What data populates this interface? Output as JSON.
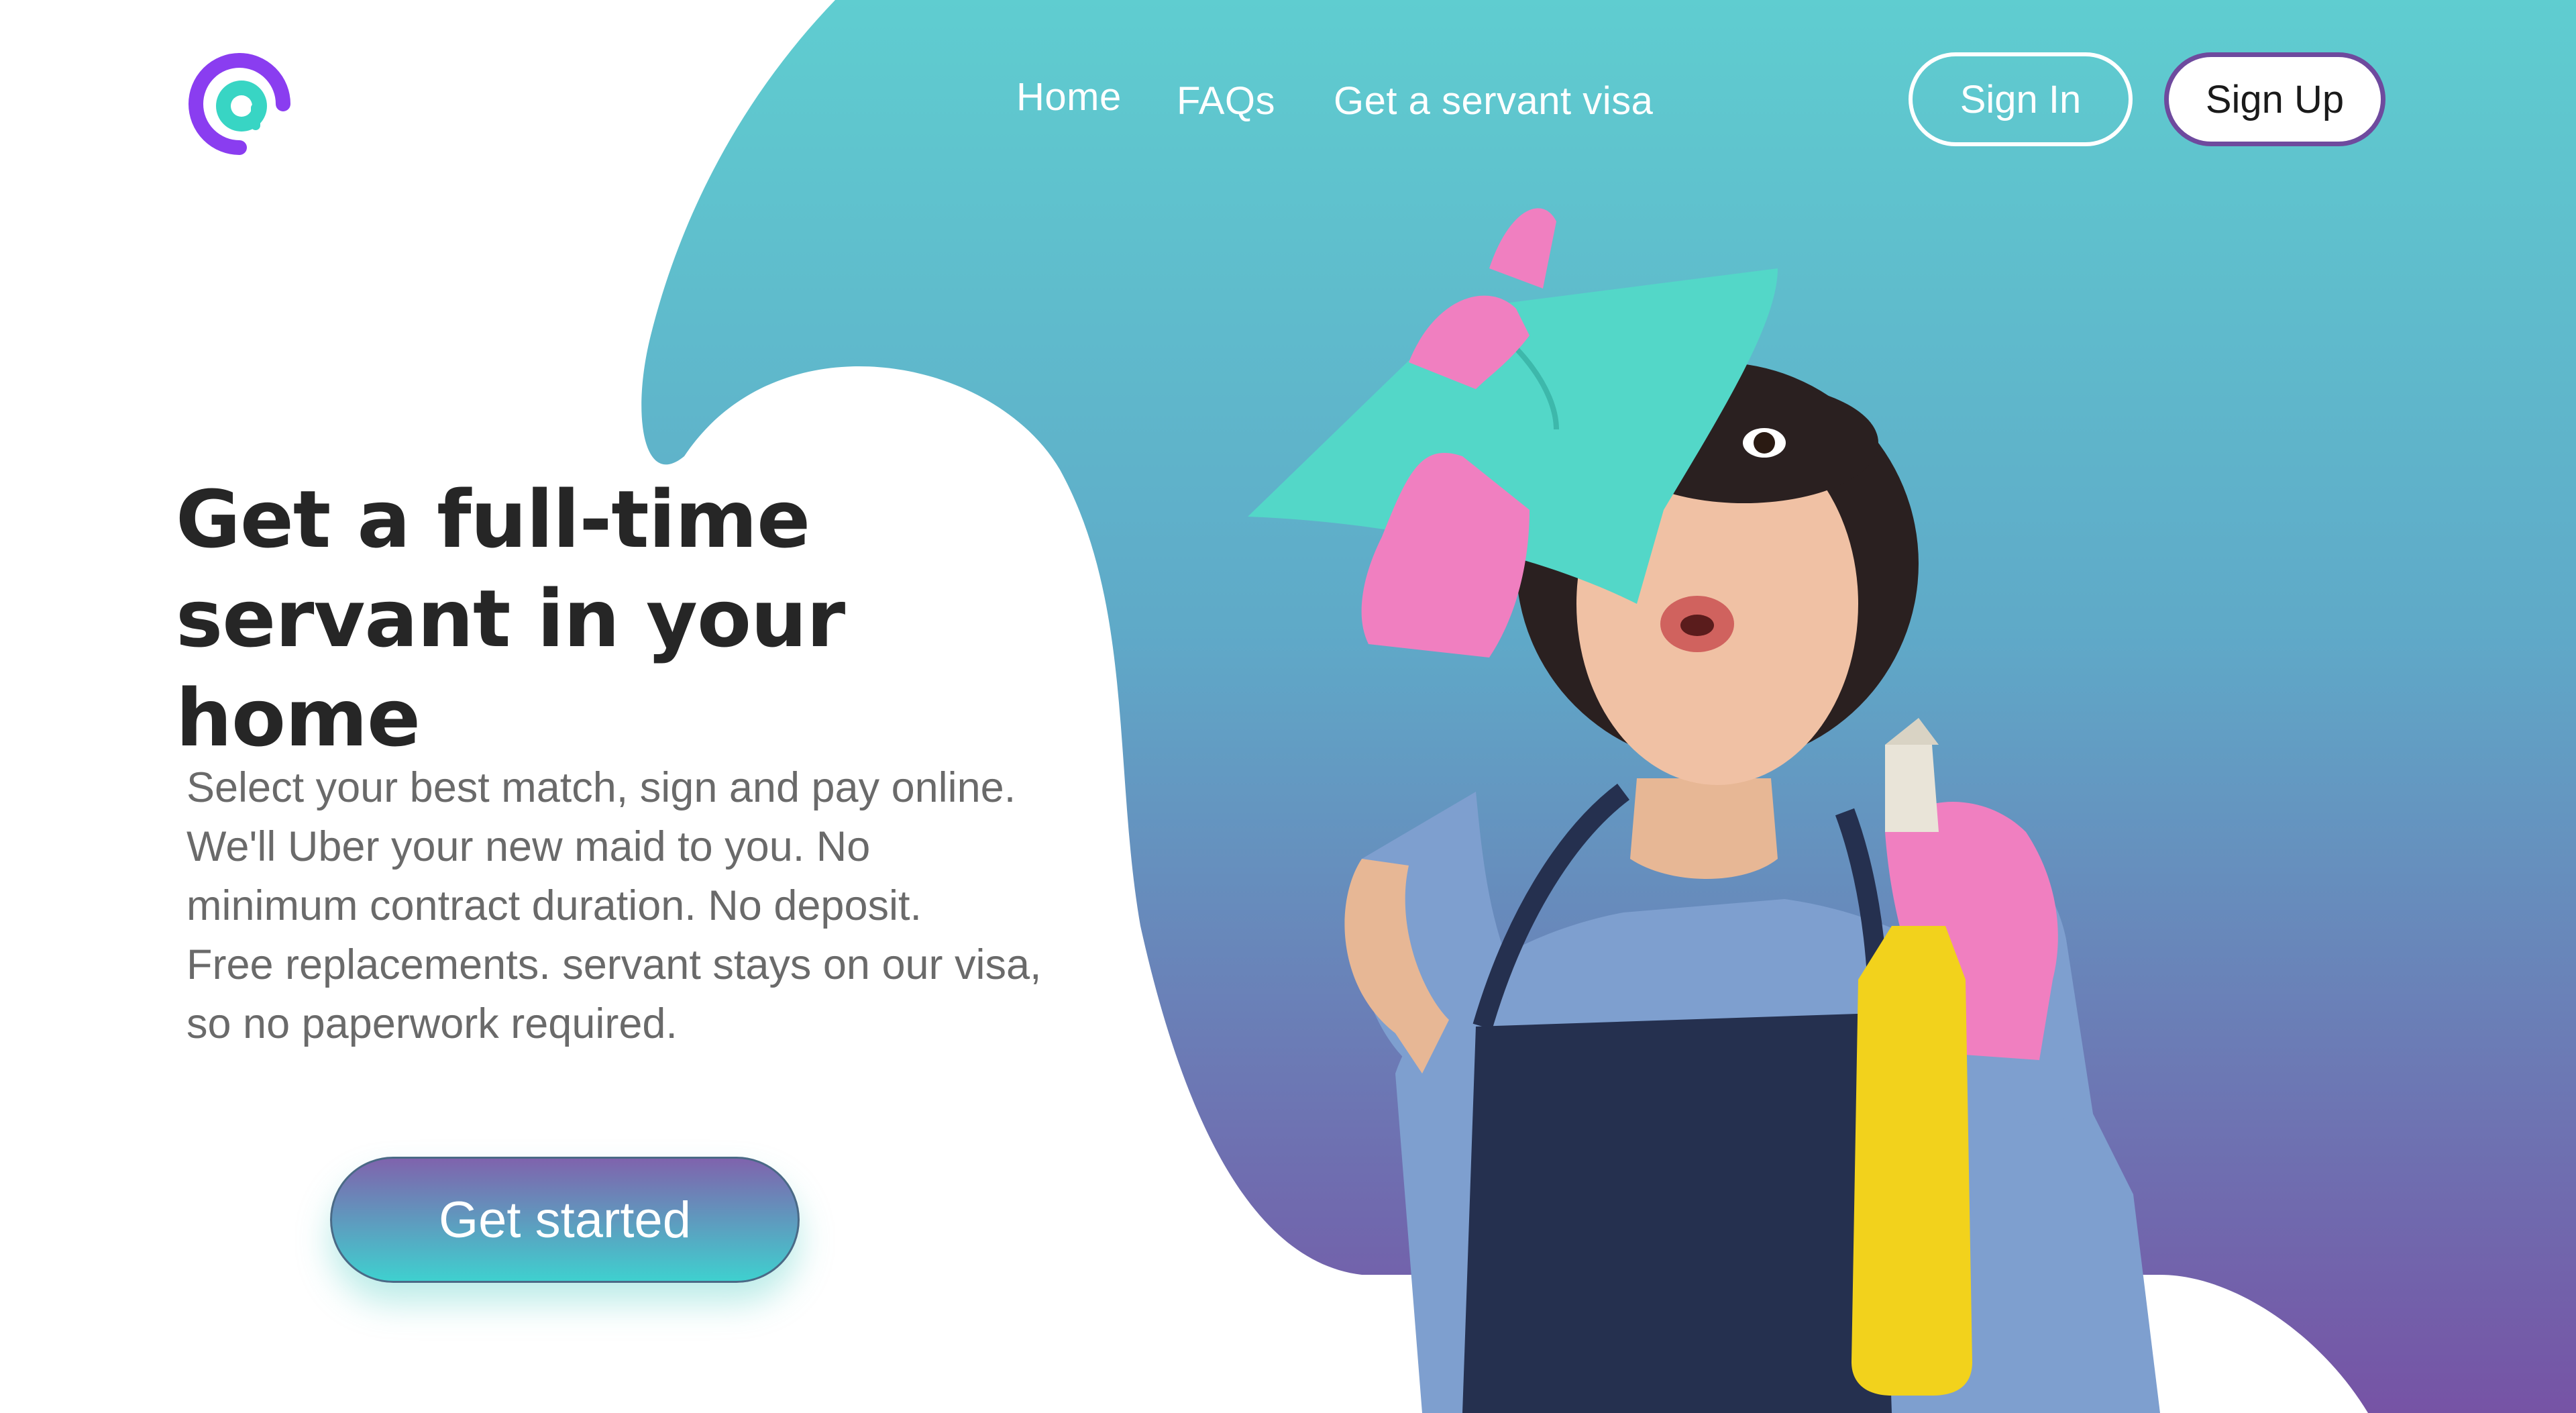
{
  "colors": {
    "gradient_top": "#5fcdd0",
    "gradient_bottom": "#7653a5",
    "logo_purple": "#8a3df0",
    "logo_teal": "#38d5c4",
    "signup_border": "#6e4a9e",
    "heading_text": "#262626",
    "body_text": "#6a6a6a"
  },
  "header": {
    "logo_icon": "at-sign-logo",
    "nav": [
      {
        "label": "Home"
      },
      {
        "label": "FAQs"
      },
      {
        "label": "Get a servant visa"
      }
    ],
    "signin_label": "Sign In",
    "signup_label": "Sign Up"
  },
  "hero": {
    "title_line1": "Get a full-time",
    "title_line2": "servant in your home",
    "description": [
      "Select your best match, sign and pay online.",
      "We'll Uber your new maid to you. No",
      "minimum contract duration. No deposit.",
      "Free replacements. servant stays on our visa,",
      "so no paperwork required."
    ],
    "cta_label": "Get started"
  },
  "image": {
    "subject": "woman-with-cleaning-cloth-and-spray-bottle"
  }
}
